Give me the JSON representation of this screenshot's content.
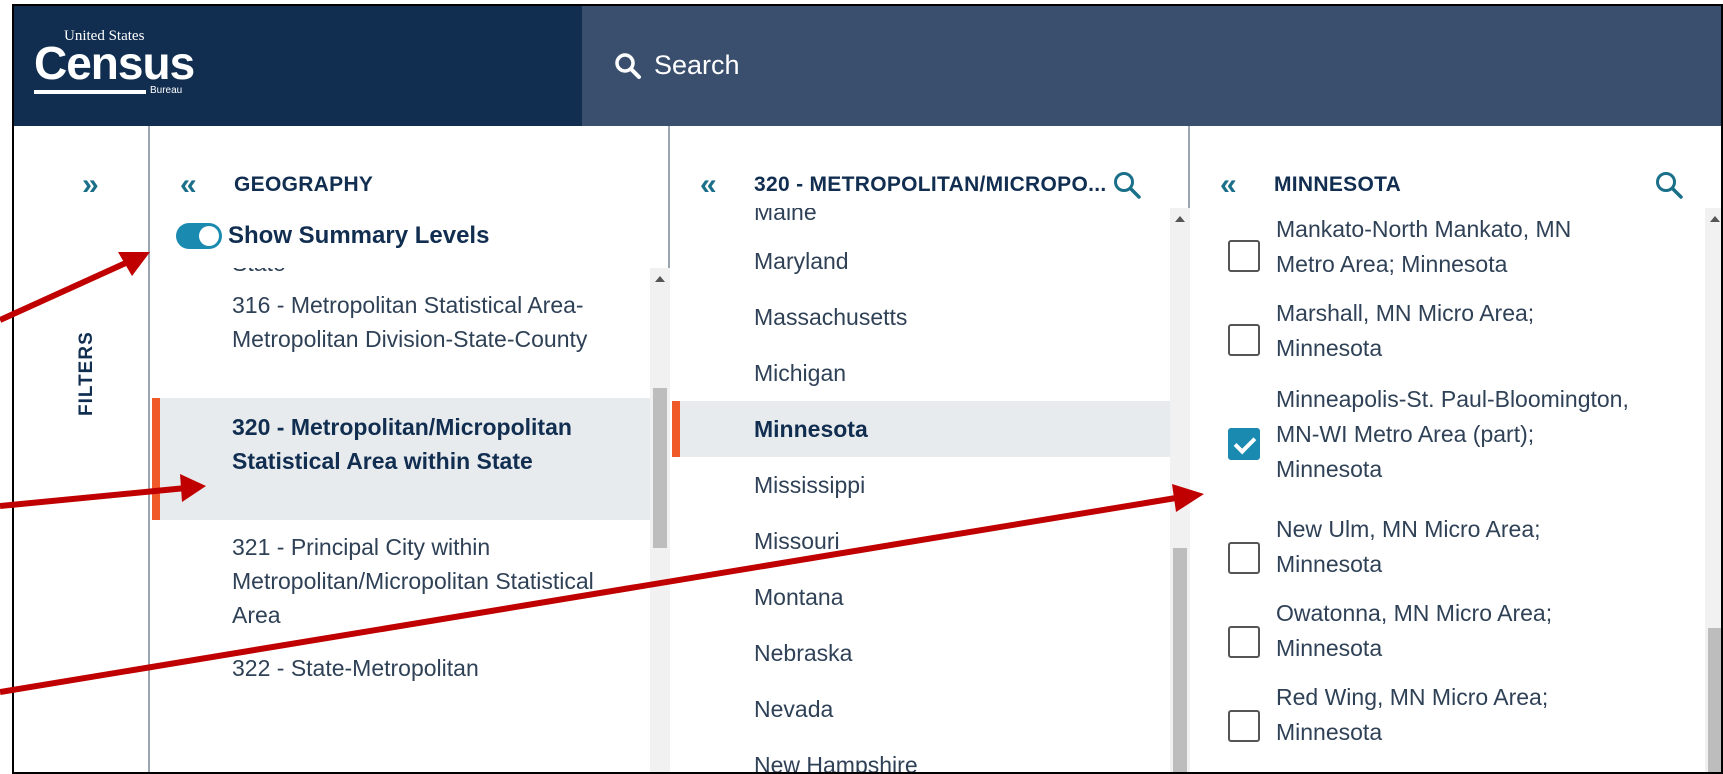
{
  "header": {
    "logo_top": "United States",
    "logo_main": "Census",
    "logo_bureau": "Bureau",
    "search_label": "Search"
  },
  "filters": {
    "label": "FILTERS"
  },
  "geography": {
    "title": "GEOGRAPHY",
    "toggle_label": "Show Summary Levels",
    "toggle_on": true,
    "items": [
      {
        "label": "State"
      },
      {
        "label": "316 - Metropolitan Statistical Area-Metropolitan Division-State-County"
      },
      {
        "label": "320 - Metropolitan/Micropolitan Statistical Area within State",
        "selected": true
      },
      {
        "label": "321 - Principal City within Metropolitan/Micropolitan Statistical Area"
      },
      {
        "label": "322 - State-Metropolitan"
      }
    ]
  },
  "states": {
    "title": "320 - METROPOLITAN/MICROPO...",
    "items": [
      {
        "label": "Maine"
      },
      {
        "label": "Maryland"
      },
      {
        "label": "Massachusetts"
      },
      {
        "label": "Michigan"
      },
      {
        "label": "Minnesota",
        "selected": true
      },
      {
        "label": "Mississippi"
      },
      {
        "label": "Missouri"
      },
      {
        "label": "Montana"
      },
      {
        "label": "Nebraska"
      },
      {
        "label": "Nevada"
      },
      {
        "label": "New Hampshire"
      }
    ]
  },
  "areas": {
    "title": "MINNESOTA",
    "items": [
      {
        "label": "Mankato-North Mankato, MN Metro Area; Minnesota",
        "checked": false
      },
      {
        "label": "Marshall, MN Micro Area; Minnesota",
        "checked": false
      },
      {
        "label": "Minneapolis-St. Paul-Bloomington, MN-WI Metro Area (part); Minnesota",
        "checked": true
      },
      {
        "label": "New Ulm, MN Micro Area; Minnesota",
        "checked": false
      },
      {
        "label": "Owatonna, MN Micro Area; Minnesota",
        "checked": false
      },
      {
        "label": "Red Wing, MN Micro Area; Minnesota",
        "checked": false
      }
    ]
  },
  "colors": {
    "header_dark": "#112e51",
    "header_bar": "#3a4f6e",
    "accent_teal": "#1a8ab0",
    "selected_marker": "#f05a28",
    "annotation_arrow": "#c00000"
  }
}
